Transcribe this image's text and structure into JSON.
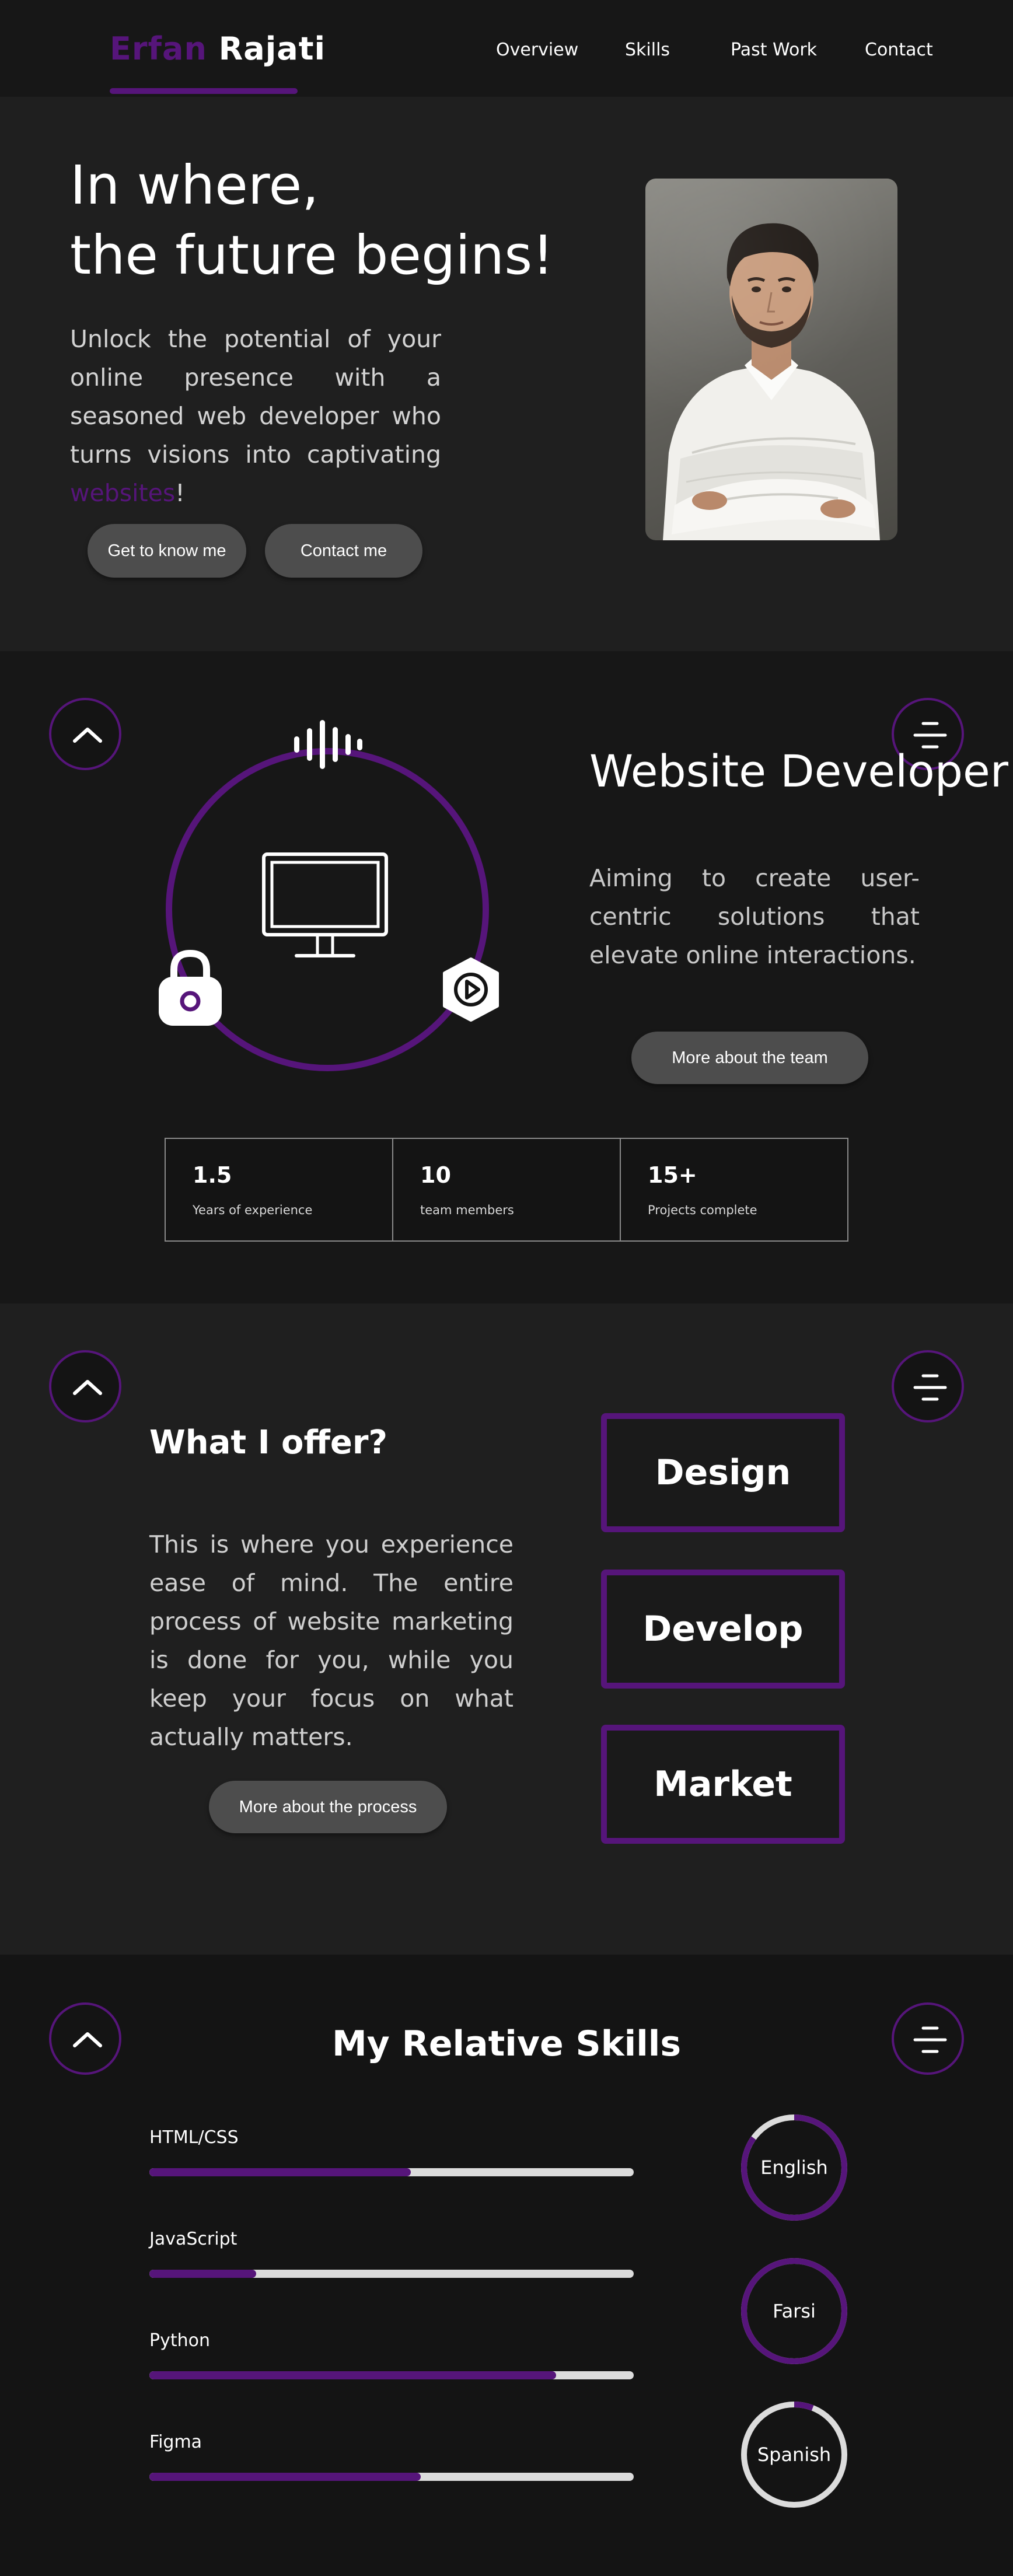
{
  "nav": {
    "logo_first": "Erfan",
    "logo_last": "Rajati",
    "links": [
      "Overview",
      "Skills",
      "Past Work",
      "Contact"
    ]
  },
  "hero": {
    "title_line1": "In where,",
    "title_line2": "the future begins!",
    "text_before": "Unlock the potential of your online presence with a seasoned web developer who turns visions into captivating ",
    "text_highlight": "websites",
    "text_after": "!",
    "btn_know": "Get to know me",
    "btn_contact": "Contact me"
  },
  "about": {
    "title": "Website Developer",
    "text": "Aiming to create user-centric solutions that elevate online interactions.",
    "button": "More about the team",
    "stats": [
      {
        "num": "1.5",
        "label": "Years of experience"
      },
      {
        "num": "10",
        "label": "team members"
      },
      {
        "num": "15+",
        "label": "Projects complete"
      }
    ]
  },
  "offer": {
    "title": "What I offer?",
    "text": "This is where you experience ease of mind. The entire process of website marketing is done for you, while you keep your focus on what actually matters.",
    "button": "More about the process",
    "cards": [
      "Design",
      "Develop",
      "Market"
    ]
  },
  "skills": {
    "title": "My Relative Skills",
    "items": [
      {
        "label": "HTML/CSS",
        "level": 0.54
      },
      {
        "label": "JavaScript",
        "level": 0.22
      },
      {
        "label": "Python",
        "level": 0.84
      },
      {
        "label": "Figma",
        "level": 0.56
      }
    ],
    "languages": [
      {
        "label": "English",
        "level": 0.85
      },
      {
        "label": "Farsi",
        "level": 1.0
      },
      {
        "label": "Spanish",
        "level": 0.06
      }
    ]
  },
  "colors": {
    "accent": "#56157a",
    "bg_dark": "#171717",
    "bg": "#1f1f1f",
    "button": "#4d4d4d"
  }
}
